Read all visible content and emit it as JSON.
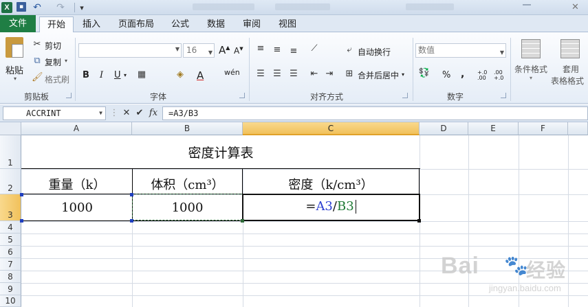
{
  "quick_access": {
    "logo": "X",
    "undo_icon": "undo-icon",
    "redo_icon": "redo-icon"
  },
  "tabs": {
    "file": "文件",
    "items": [
      "开始",
      "插入",
      "页面布局",
      "公式",
      "数据",
      "审阅",
      "视图"
    ],
    "active": "开始"
  },
  "ribbon": {
    "clipboard": {
      "paste": "粘贴",
      "cut": "剪切",
      "copy": "复制",
      "format_painter": "格式刷",
      "group": "剪贴板"
    },
    "font": {
      "size": "16",
      "bold": "B",
      "italic": "I",
      "underline": "U",
      "grow": "A",
      "shrink": "A",
      "wen": "wén",
      "color": "A",
      "group": "字体"
    },
    "alignment": {
      "wrap": "自动换行",
      "merge": "合并后居中",
      "group": "对齐方式"
    },
    "number": {
      "format": "数值",
      "percent": "%",
      "comma": ",",
      "inc_decimal": "+.0 .00",
      "dec_decimal": ".00 +.0",
      "group": "数字"
    },
    "styles": {
      "conditional": "条件格式",
      "table_line1": "套用",
      "table_line2": "表格格式"
    }
  },
  "formula_bar": {
    "name_box": "ACCRINT",
    "cancel": "✕",
    "enter": "✔",
    "fx": "fx",
    "formula": "=A3/B3"
  },
  "sheet": {
    "columns": [
      "A",
      "B",
      "C",
      "D",
      "E",
      "F"
    ],
    "rows": [
      "1",
      "2",
      "3",
      "4",
      "5",
      "6",
      "7",
      "8",
      "9",
      "10"
    ],
    "title": "密度计算表",
    "headers": [
      "重量（k）",
      "体积（cm³）",
      "密度（k/cm³）"
    ],
    "weight_value": "1000",
    "volume_value": "1000",
    "formula_eq": "=",
    "formula_ref_a": "A3",
    "formula_slash": "/",
    "formula_ref_b": "B3",
    "active_cell": "C3",
    "colors": {
      "ref_a": "#2b3fd1",
      "ref_b": "#1f7a35",
      "selected_header": "#f1c15b",
      "file_tab": "#1f7e44"
    }
  },
  "watermark": {
    "main": "Bai",
    "main2": "经验",
    "sub": "jingyan.baidu.com"
  }
}
